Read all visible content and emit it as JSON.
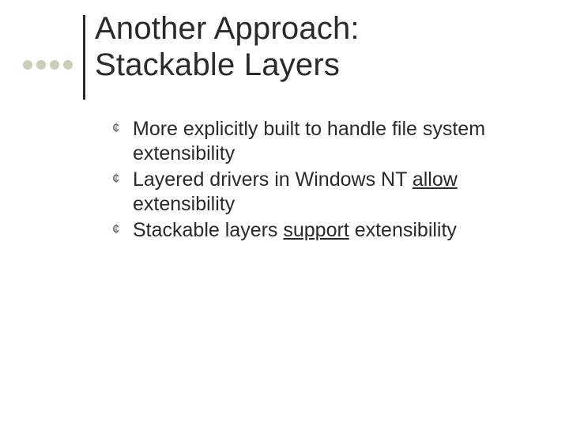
{
  "title_line1": "Another Approach:",
  "title_line2": "Stackable Layers",
  "bullets": [
    {
      "pre": "More explicitly built to handle file system extensibility",
      "u": "",
      "post": ""
    },
    {
      "pre": "Layered drivers in Windows NT ",
      "u": "allow",
      "post": " extensibility"
    },
    {
      "pre": "Stackable layers ",
      "u": "support",
      "post": " extensibility"
    }
  ],
  "bullet_glyph": "¢"
}
